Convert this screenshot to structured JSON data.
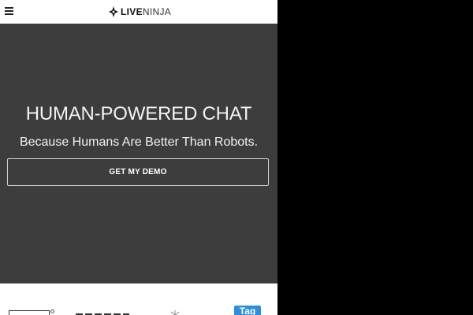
{
  "header": {
    "menu_icon": "hamburger-menu-icon",
    "logo": {
      "icon": "ninja-star-icon",
      "text_strong": "LIVE",
      "text_light": "NINJA"
    }
  },
  "hero": {
    "title": "HUMAN-POWERED CHAT",
    "subtitle": "Because Humans Are Better Than Robots.",
    "cta_label": "GET MY DEMO"
  },
  "clients": {
    "logos": [
      "client-logo-1",
      "client-logo-2",
      "client-logo-3",
      "client-logo-4"
    ],
    "logo_4_text": "Tag"
  },
  "colors": {
    "hero_background": "#3d3d3d",
    "page_background": "#ffffff",
    "outside_background": "#000000",
    "hero_text": "#f2f2f2",
    "button_border": "#cfcfcf",
    "client_logo_4": "#2b8fe0"
  }
}
